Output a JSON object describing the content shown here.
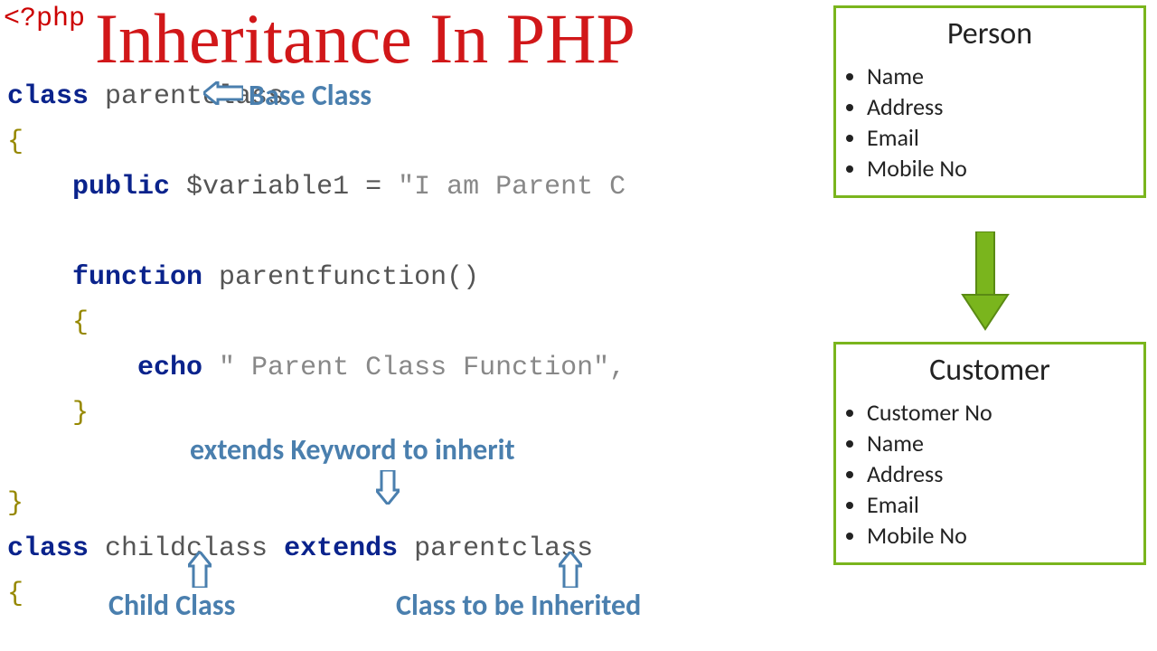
{
  "php_open": "<?php",
  "title": "Inheritance In PHP",
  "code": {
    "l1_kw": "class",
    "l1_id": " parentclass",
    "l3_kw": "public",
    "l3_var": " $variable1",
    "l3_eq": " = ",
    "l3_str": "\"I am Parent C",
    "l5_kw": "function",
    "l5_id": " parentfunction",
    "l5_p": "()",
    "l7_kw": "echo",
    "l7_str": " \" Parent Class Function\",",
    "l10_kwA": "class",
    "l10_idA": " childclass ",
    "l10_kwB": "extends",
    "l10_idB": " parentclass"
  },
  "annotations": {
    "base": "Base Class",
    "extends": "extends Keyword to inherit",
    "child": "Child Class",
    "inherited": "Class to be Inherited"
  },
  "person": {
    "title": "Person",
    "items": [
      "Name",
      "Address",
      "Email",
      "Mobile No"
    ]
  },
  "customer": {
    "title": "Customer",
    "items": [
      "Customer No",
      "Name",
      "Address",
      "Email",
      "Mobile No"
    ]
  }
}
